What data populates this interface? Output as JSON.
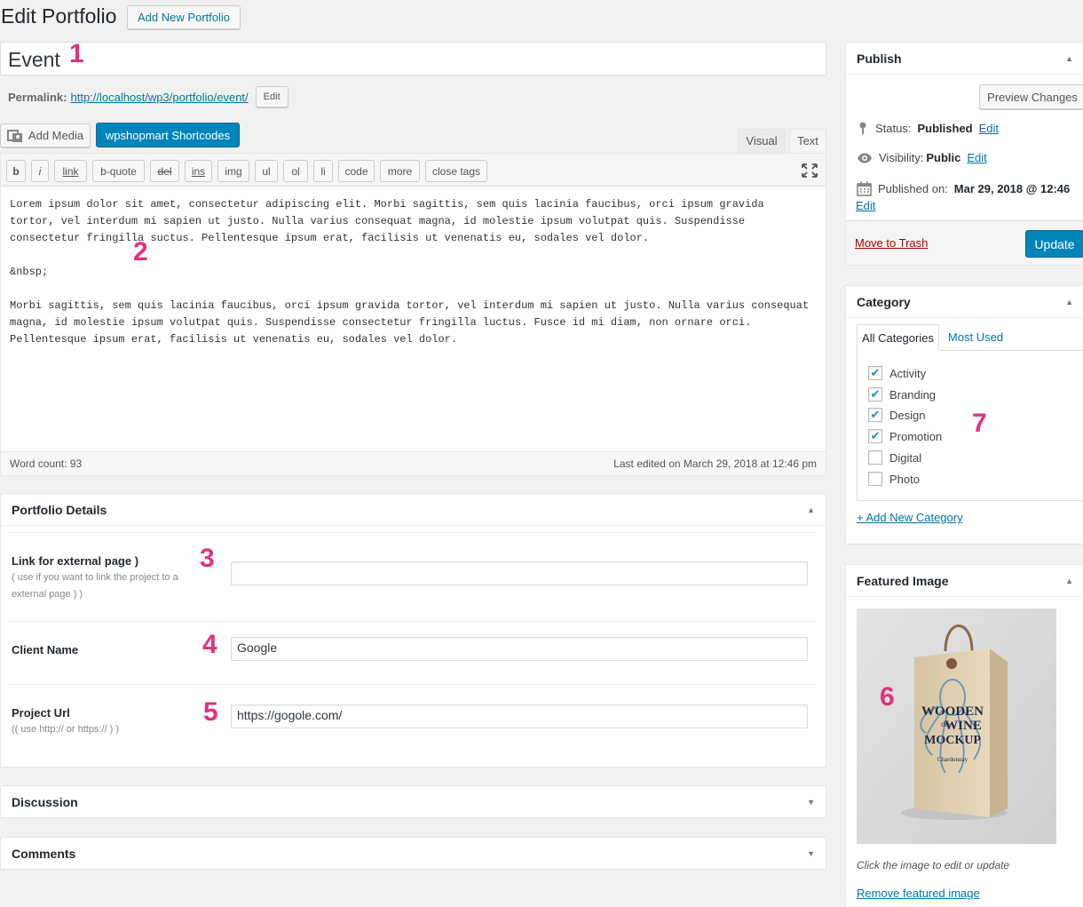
{
  "header": {
    "title": "Edit Portfolio",
    "add_new_label": "Add New Portfolio"
  },
  "post": {
    "title_value": "Event",
    "permalink_label": "Permalink:",
    "permalink_url": "http://localhost/wp3/portfolio/event/",
    "permalink_edit": "Edit"
  },
  "editor": {
    "add_media_label": "Add Media",
    "shortcodes_label": "wpshopmart Shortcodes",
    "tabs": [
      {
        "label": "Visual"
      },
      {
        "label": "Text"
      }
    ],
    "quicktags": [
      "b",
      "i",
      "link",
      "b-quote",
      "del",
      "ins",
      "img",
      "ul",
      "ol",
      "li",
      "code",
      "more",
      "close tags"
    ],
    "content": "Lorem ipsum dolor sit amet, consectetur adipiscing elit. Morbi sagittis, sem quis lacinia faucibus, orci ipsum gravida\ntortor, vel interdum mi sapien ut justo. Nulla varius consequat magna, id molestie ipsum volutpat quis. Suspendisse\nconsectetur fringilla suctus. Pellentesque ipsum erat, facilisis ut venenatis eu, sodales vel dolor.\n\n&nbsp;\n\nMorbi sagittis, sem quis lacinia faucibus, orci ipsum gravida tortor, vel interdum mi sapien ut justo. Nulla varius consequat\nmagna, id molestie ipsum volutpat quis. Suspendisse consectetur fringilla luctus. Fusce id mi diam, non ornare orci.\nPellentesque ipsum erat, facilisis ut venenatis eu, sodales vel dolor.",
    "word_count": "Word count: 93",
    "last_edited": "Last edited on March 29, 2018 at 12:46 pm"
  },
  "portfolio_details": {
    "title": "Portfolio Details",
    "fields": [
      {
        "label": "Link for external page )",
        "note": "( use if you want to link the project to a external page ) )",
        "value": ""
      },
      {
        "label": "Client Name",
        "note": "",
        "value": "Google"
      },
      {
        "label": "Project Url",
        "note": "(( use http:// or https:// ) )",
        "value": "https://gogole.com/"
      }
    ]
  },
  "collapsed_boxes": [
    {
      "title": "Discussion"
    },
    {
      "title": "Comments"
    }
  ],
  "publish": {
    "title": "Publish",
    "preview_label": "Preview Changes",
    "status_label": "Status:",
    "status_value": "Published",
    "visibility_label": "Visibility:",
    "visibility_value": "Public",
    "published_label": "Published on:",
    "published_value": "Mar 29, 2018 @ 12:46",
    "edit_link": "Edit",
    "trash_label": "Move to Trash",
    "update_label": "Update"
  },
  "category": {
    "title": "Category",
    "tabs": [
      {
        "label": "All Categories"
      },
      {
        "label": "Most Used"
      }
    ],
    "items": [
      {
        "label": "Activity",
        "checked": true
      },
      {
        "label": "Branding",
        "checked": true
      },
      {
        "label": "Design",
        "checked": true
      },
      {
        "label": "Promotion",
        "checked": true
      },
      {
        "label": "Digital",
        "checked": false
      },
      {
        "label": "Photo",
        "checked": false
      }
    ],
    "add_new_label": "+ Add New Category"
  },
  "featured_image": {
    "title": "Featured Image",
    "product_text": [
      "WOODEN",
      "the",
      "WINE",
      "MOCKUP",
      "Chardonnay"
    ],
    "hint": "Click the image to edit or update",
    "remove_label": "Remove featured image"
  },
  "annotations": [
    "1",
    "2",
    "3",
    "4",
    "5",
    "6",
    "7"
  ],
  "colors": {
    "primary": "#0085ba",
    "link": "#0073aa",
    "trash": "#a00",
    "annotation": "#e0327d"
  }
}
